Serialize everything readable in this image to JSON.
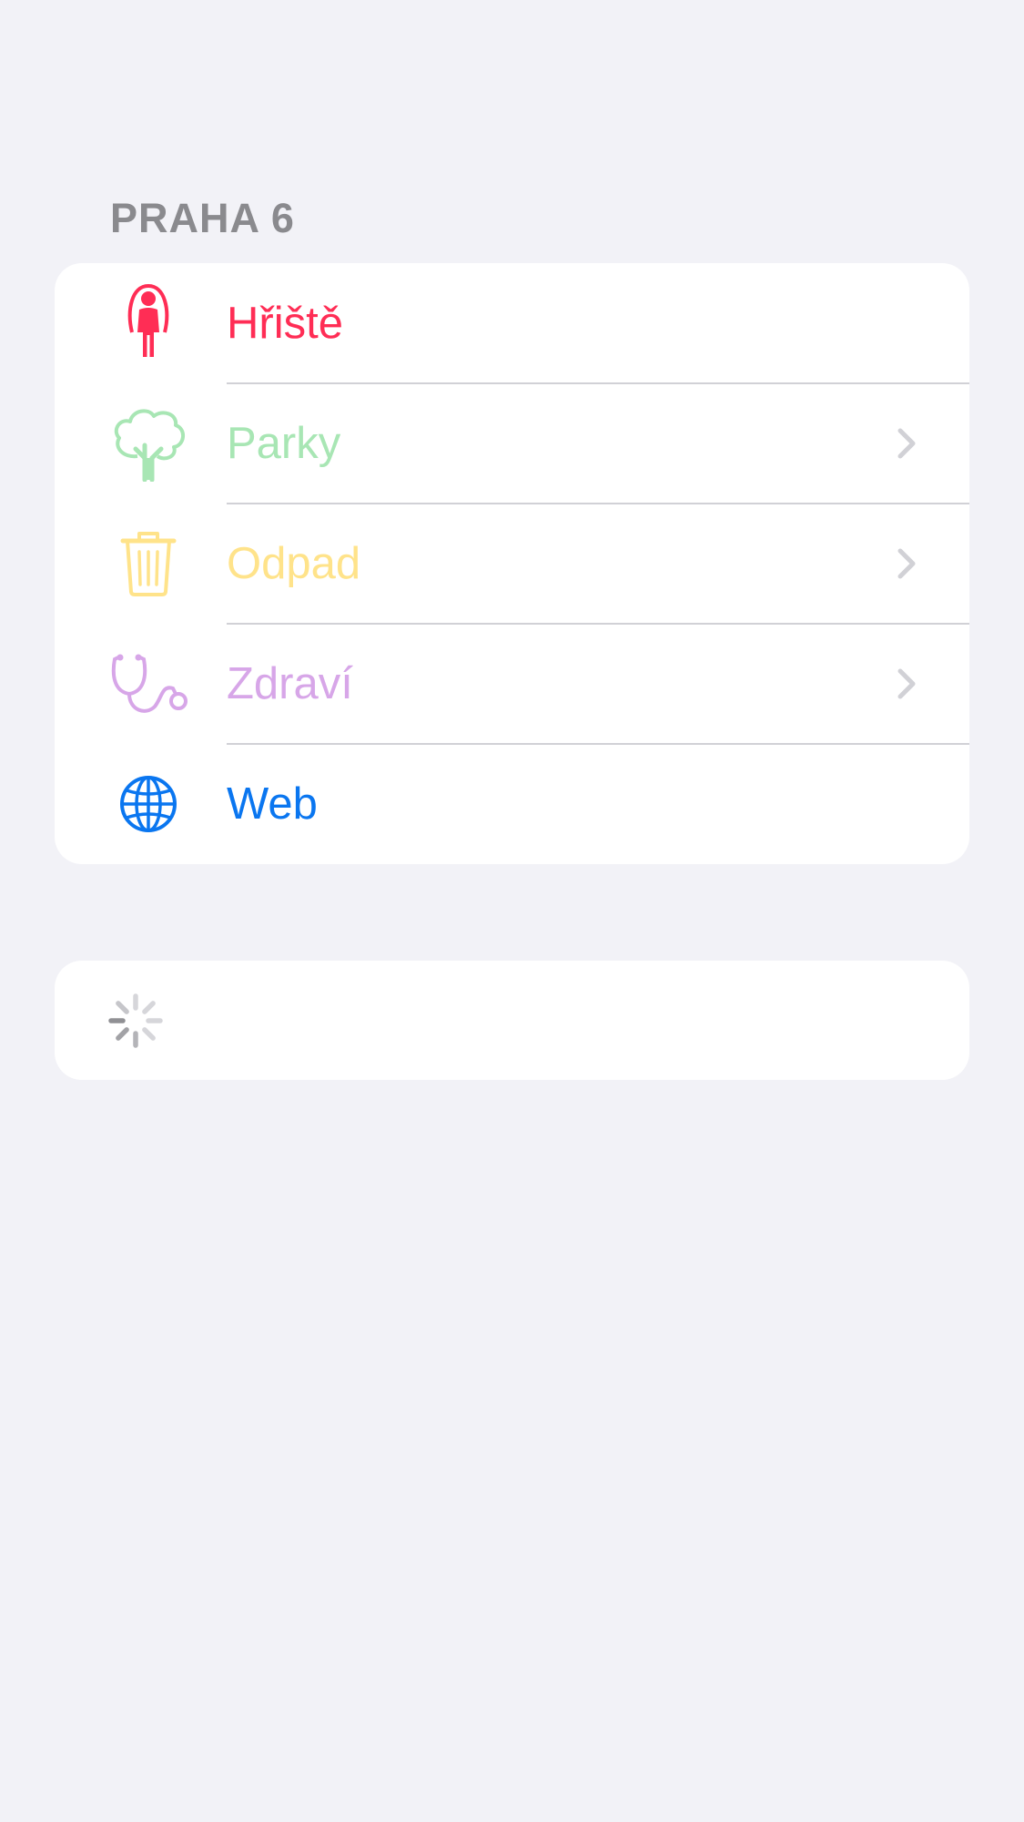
{
  "section": {
    "title": "PRAHA 6"
  },
  "menu": {
    "items": [
      {
        "label": "Hřiště",
        "icon": "jump-rope-figure-icon",
        "color": "#ff2d55",
        "has_chevron": false
      },
      {
        "label": "Parky",
        "icon": "tree-icon",
        "color": "#a8e6b4",
        "has_chevron": true
      },
      {
        "label": "Odpad",
        "icon": "trash-icon",
        "color": "#ffe38a",
        "has_chevron": true
      },
      {
        "label": "Zdraví",
        "icon": "stethoscope-icon",
        "color": "#d7a6e8",
        "has_chevron": true
      },
      {
        "label": "Web",
        "icon": "globe-icon",
        "color": "#0a76f0",
        "has_chevron": false
      }
    ]
  },
  "loading": {
    "icon": "activity-spinner-icon"
  },
  "colors": {
    "background": "#f2f2f7",
    "header": "#8a8a8e",
    "chevron": "#d1d1d6",
    "separator": "#d1d1d6"
  }
}
